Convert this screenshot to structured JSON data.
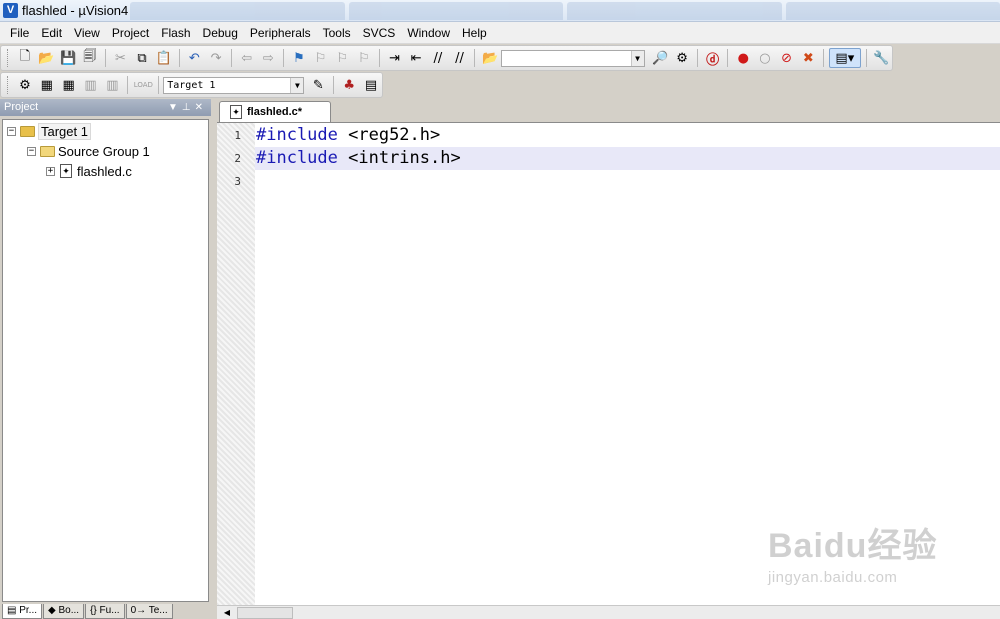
{
  "window": {
    "title": "flashled  - µVision4"
  },
  "menu": [
    "File",
    "Edit",
    "View",
    "Project",
    "Flash",
    "Debug",
    "Peripherals",
    "Tools",
    "SVCS",
    "Window",
    "Help"
  ],
  "toolbar": {
    "target_combo_value": "Target 1",
    "find_combo_value": ""
  },
  "project_panel": {
    "title": "Project",
    "tree": {
      "target": "Target 1",
      "group": "Source Group 1",
      "file": "flashled.c"
    },
    "tabs": [
      "Pr...",
      "Bo...",
      "Fu...",
      "Te..."
    ]
  },
  "editor": {
    "tab_label": "flashled.c*",
    "lines": [
      {
        "number": "1",
        "keyword": "#include",
        "rest": " <reg52.h>"
      },
      {
        "number": "2",
        "keyword": "#include",
        "rest": " <intrins.h>"
      },
      {
        "number": "3",
        "keyword": "",
        "rest": ""
      }
    ],
    "current_line": 2
  },
  "watermark": {
    "logo": "Baidu经验",
    "url": "jingyan.baidu.com"
  },
  "colors": {
    "keyword": "#1a1ab4",
    "current_line_bg": "#e8e8f8",
    "panel_header": "#8f9cb1"
  }
}
